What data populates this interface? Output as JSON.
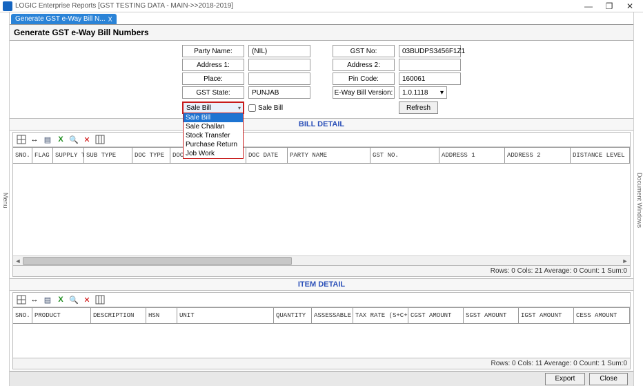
{
  "window": {
    "title": "LOGIC Enterprise Reports  [GST TESTING DATA - MAIN->>2018-2019]",
    "left_tab": "Menu",
    "right_tab": "Document Windows"
  },
  "doc_tab": {
    "label": "Generate GST e-Way Bill N...",
    "close": "X"
  },
  "heading": "Generate GST e-Way Bill Numbers",
  "form": {
    "party_name_lbl": "Party Name:",
    "party_name_val": "(NIL)",
    "gst_no_lbl": "GST No:",
    "gst_no_val": "03BUDPS3456F1Z1",
    "address1_lbl": "Address 1:",
    "address1_val": "",
    "address2_lbl": "Address 2:",
    "address2_val": "",
    "place_lbl": "Place:",
    "place_val": "",
    "pin_lbl": "Pin Code:",
    "pin_val": "160061",
    "gst_state_lbl": "GST State:",
    "gst_state_val": "PUNJAB",
    "eway_ver_lbl": "E-Way Bill Version:",
    "eway_ver_val": "1.0.1118",
    "doc_type_selected": "Sale Bill",
    "doc_type_options": [
      "Sale Bill",
      "Sale Challan",
      "Stock Transfer",
      "Purchase Return",
      "Job Work"
    ],
    "sale_bill_chk_label": "Sale Bill",
    "refresh": "Refresh"
  },
  "bill_panel": {
    "title": "BILL DETAIL",
    "columns": [
      "SNO.",
      "FLAG",
      "SUPPLY TYPE",
      "SUB TYPE",
      "DOC TYPE",
      "DOC NO.",
      "DOC DATE",
      "PARTY NAME",
      "GST NO.",
      "ADDRESS 1",
      "ADDRESS 2",
      "DISTANCE LEVEL (KM)"
    ],
    "status": "Rows: 0  Cols: 21  Average: 0  Count: 1  Sum:0"
  },
  "item_panel": {
    "title": "ITEM DETAIL",
    "columns": [
      "SNO.",
      "PRODUCT",
      "DESCRIPTION",
      "HSN",
      "UNIT",
      "QUANTITY",
      "ASSESSABLE VALUE",
      "TAX RATE (S+C+I+CESS)",
      "CGST AMOUNT",
      "SGST AMOUNT",
      "IGST AMOUNT",
      "CESS AMOUNT"
    ],
    "status": "Rows: 0  Cols: 11  Average: 0  Count: 1  Sum:0"
  },
  "footer": {
    "export": "Export",
    "close": "Close"
  },
  "icons": {
    "minimize": "—",
    "maximize": "❐",
    "close": "✕"
  }
}
